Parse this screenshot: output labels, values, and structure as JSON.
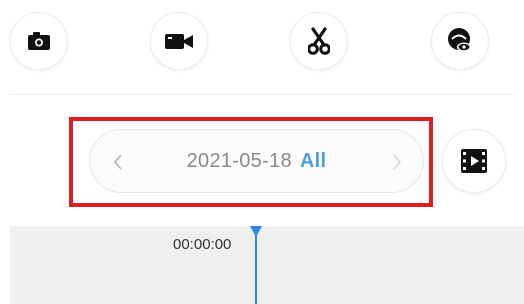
{
  "toolbar": {
    "buttons": [
      {
        "icon": "camera-icon"
      },
      {
        "icon": "video-camera-icon"
      },
      {
        "icon": "scissors-icon"
      },
      {
        "icon": "privacy-eye-icon"
      }
    ]
  },
  "date_selector": {
    "date": "2021-05-18",
    "filter": "All",
    "prev_icon": "chevron-left-icon",
    "next_icon": "chevron-right-icon"
  },
  "playback_button": {
    "icon": "film-play-icon"
  },
  "timeline": {
    "time": "00:00:00",
    "colors": {
      "playhead": "#2f86e0",
      "filter_accent": "#4f9fe0",
      "highlight_box": "#e11d24"
    }
  }
}
